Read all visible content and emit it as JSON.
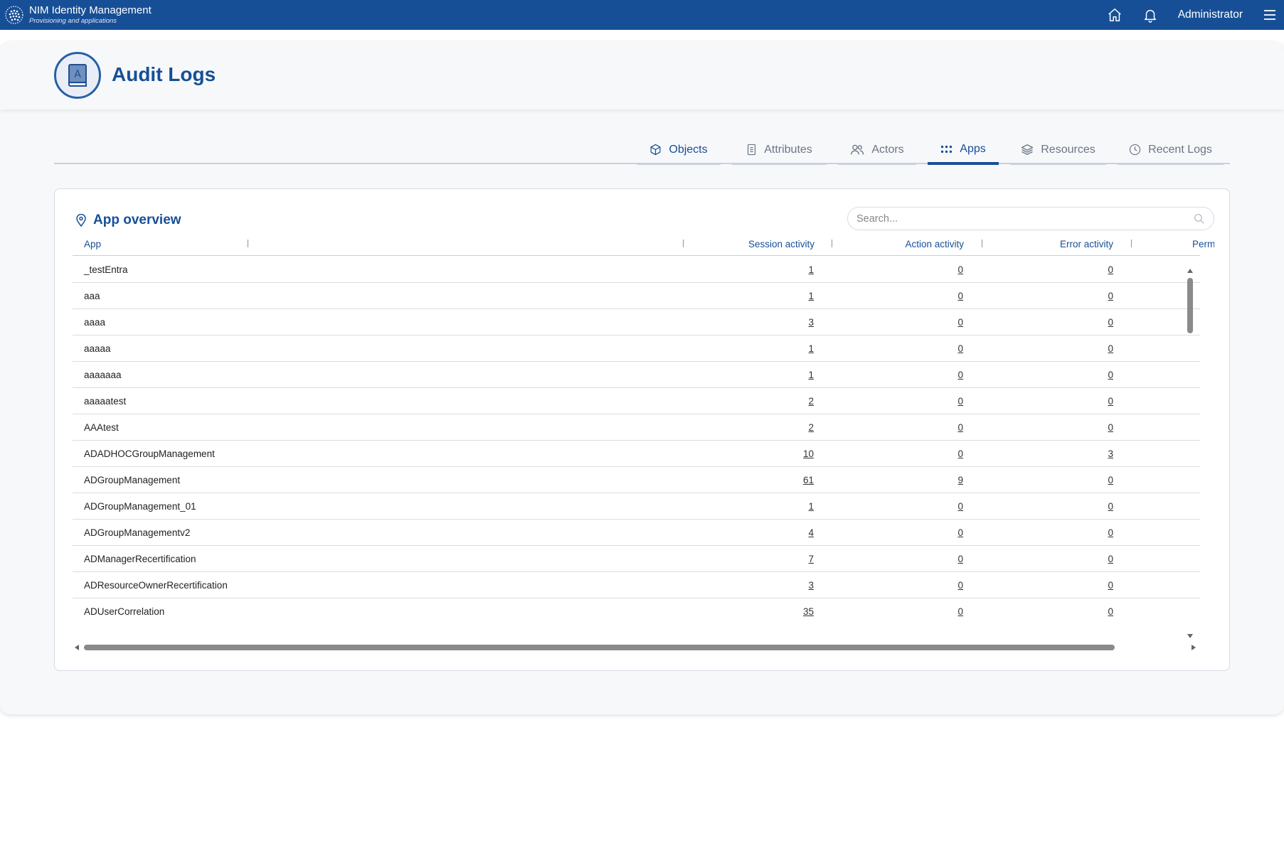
{
  "topbar": {
    "app_title": "NIM Identity Management",
    "app_subtitle": "Provisioning and applications",
    "user": "Administrator",
    "icons": [
      "home-icon",
      "bell-icon",
      "hamburger-menu-icon"
    ],
    "bg_color": "#174f97"
  },
  "page": {
    "title": "Audit Logs",
    "icon": "audit-book-icon"
  },
  "tabs": [
    {
      "label": "Objects",
      "icon": "cube-icon",
      "active": false
    },
    {
      "label": "Attributes",
      "icon": "document-icon",
      "active": false
    },
    {
      "label": "Actors",
      "icon": "users-icon",
      "active": false
    },
    {
      "label": "Apps",
      "icon": "apps-grid-icon",
      "active": true
    },
    {
      "label": "Resources",
      "icon": "layers-icon",
      "active": false
    },
    {
      "label": "Recent Logs",
      "icon": "clock-icon",
      "active": false
    }
  ],
  "panel": {
    "title": "App overview",
    "title_icon": "location-pin-icon",
    "search_placeholder": "Search..."
  },
  "table": {
    "columns": [
      "App",
      "Session activity",
      "Action activity",
      "Error activity",
      "Perm"
    ],
    "rows": [
      {
        "app": "_testEntra",
        "session": "1",
        "action": "0",
        "error": "0"
      },
      {
        "app": "aaa",
        "session": "1",
        "action": "0",
        "error": "0"
      },
      {
        "app": "aaaa",
        "session": "3",
        "action": "0",
        "error": "0"
      },
      {
        "app": "aaaaa",
        "session": "1",
        "action": "0",
        "error": "0"
      },
      {
        "app": "aaaaaaa",
        "session": "1",
        "action": "0",
        "error": "0"
      },
      {
        "app": "aaaaatest",
        "session": "2",
        "action": "0",
        "error": "0"
      },
      {
        "app": "AAAtest",
        "session": "2",
        "action": "0",
        "error": "0"
      },
      {
        "app": "ADADHOCGroupManagement",
        "session": "10",
        "action": "0",
        "error": "3"
      },
      {
        "app": "ADGroupManagement",
        "session": "61",
        "action": "9",
        "error": "0"
      },
      {
        "app": "ADGroupManagement_01",
        "session": "1",
        "action": "0",
        "error": "0"
      },
      {
        "app": "ADGroupManagementv2",
        "session": "4",
        "action": "0",
        "error": "0"
      },
      {
        "app": "ADManagerRecertification",
        "session": "7",
        "action": "0",
        "error": "0"
      },
      {
        "app": "ADResourceOwnerRecertification",
        "session": "3",
        "action": "0",
        "error": "0"
      },
      {
        "app": "ADUserCorrelation",
        "session": "35",
        "action": "0",
        "error": "0"
      }
    ]
  }
}
